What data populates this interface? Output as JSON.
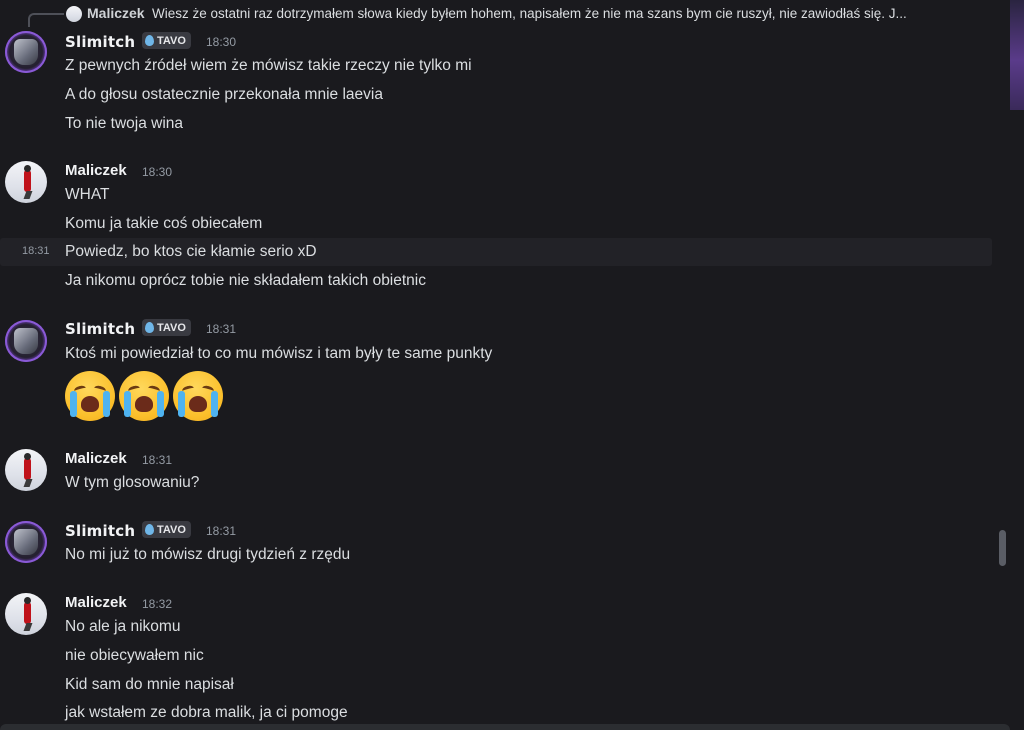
{
  "reply": {
    "author": "Maliczek",
    "text": "Wiesz że ostatni raz dotrzymałem słowa kiedy byłem hohem, napisałem że nie ma szans bym cie ruszył, nie zawiodłaś się. J..."
  },
  "groups": [
    {
      "author": "Slimitch",
      "tag": "TAVO",
      "time": "18:30",
      "lines": [
        "Z pewnych źródeł wiem że mówisz takie rzeczy nie tylko mi",
        "A do głosu ostatecznie przekonała mnie laevia",
        "To nie twoja wina"
      ]
    },
    {
      "author": "Maliczek",
      "time": "18:30",
      "lines": [
        "WHAT",
        "Komu ja takie coś obiecałem",
        "Powiedz, bo ktos cie kłamie serio xD",
        "Ja nikomu oprócz tobie nie składałem takich obietnic"
      ],
      "hover_time": "18:31"
    },
    {
      "author": "Slimitch",
      "tag": "TAVO",
      "time": "18:31",
      "lines": [
        "Ktoś mi powiedział to co mu mówisz i tam były te same punkty"
      ],
      "emojis": [
        "loudly-crying-face",
        "loudly-crying-face",
        "loudly-crying-face"
      ]
    },
    {
      "author": "Maliczek",
      "time": "18:31",
      "lines": [
        "W tym glosowaniu?"
      ]
    },
    {
      "author": "Slimitch",
      "tag": "TAVO",
      "time": "18:31",
      "lines": [
        "No mi już to mówisz drugi tydzień z rzędu"
      ]
    },
    {
      "author": "Maliczek",
      "time": "18:32",
      "lines": [
        "No ale ja nikomu",
        "nie obiecywałem nic",
        "Kid sam do mnie napisał",
        "jak wstałem ze dobra malik, ja ci pomoge"
      ]
    }
  ],
  "colors": {
    "background": "#1a1a1e",
    "text": "#dbdee1",
    "username": "#f2f3f5",
    "timestamp": "#949ba4",
    "tag_drop": "#6fb6e8"
  }
}
